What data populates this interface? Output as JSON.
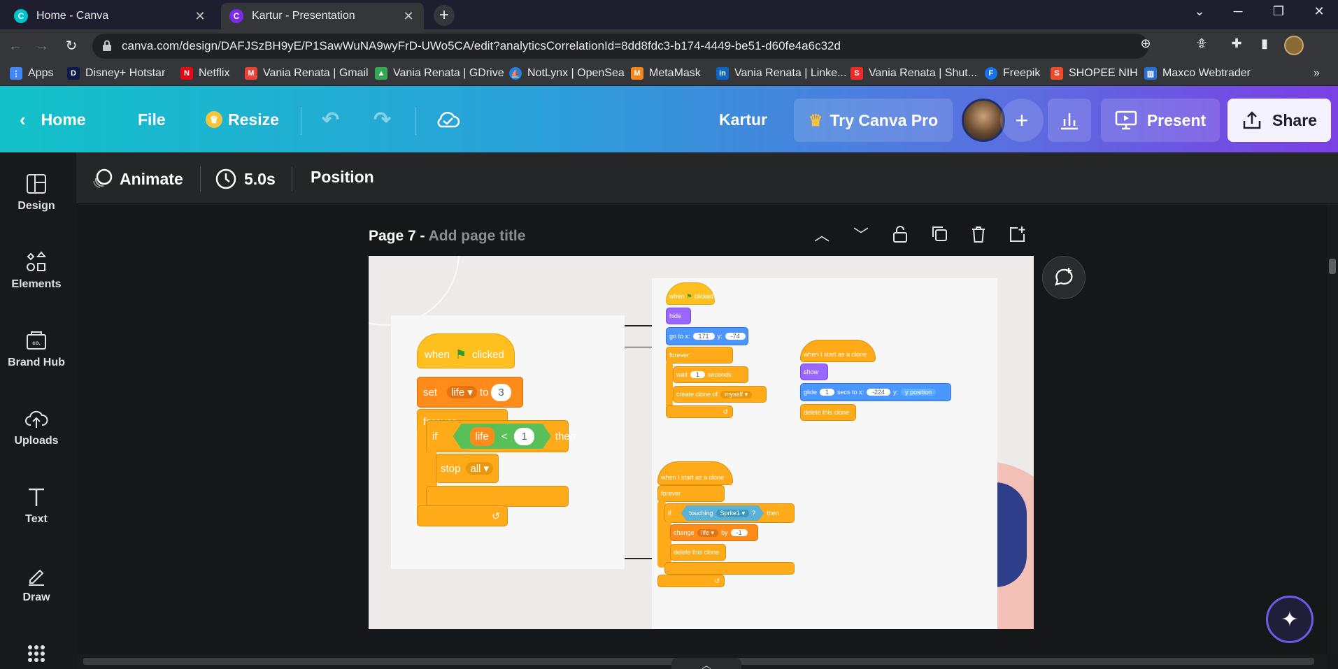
{
  "browser": {
    "tabs": [
      {
        "title": "Home - Canva",
        "active": false
      },
      {
        "title": "Kartur - Presentation",
        "active": true
      }
    ],
    "url": "canva.com/design/DAFJSzBH9yE/P1SawWuNA9wyFrD-UWo5CA/edit?analyticsCorrelationId=8dd8fdc3-b174-4449-be51-d60fe4a6c32d",
    "bookmarks": [
      {
        "label": "Apps",
        "icon": "apps-grid-icon",
        "color": "#4285f4"
      },
      {
        "label": "Disney+ Hotstar",
        "icon": "hotstar-icon",
        "color": "#0c1a4a"
      },
      {
        "label": "Netflix",
        "icon": "netflix-icon",
        "color": "#e50914"
      },
      {
        "label": "Vania Renata | Gmail",
        "icon": "gmail-icon",
        "color": "#ea4335"
      },
      {
        "label": "Vania Renata | GDrive",
        "icon": "gdrive-icon",
        "color": "#34a853"
      },
      {
        "label": "NotLynx | OpenSea",
        "icon": "opensea-icon",
        "color": "#2081e2"
      },
      {
        "label": "MetaMask",
        "icon": "metamask-icon",
        "color": "#f6851b"
      },
      {
        "label": "Vania Renata | Linke...",
        "icon": "linkedin-icon",
        "color": "#0a66c2"
      },
      {
        "label": "Vania Renata | Shut...",
        "icon": "shutterstock-icon",
        "color": "#ee2b24"
      },
      {
        "label": "Freepik",
        "icon": "freepik-icon",
        "color": "#1273eb"
      },
      {
        "label": "SHOPEE NIH",
        "icon": "shopee-icon",
        "color": "#ee4d2d"
      },
      {
        "label": "Maxco Webtrader",
        "icon": "maxco-icon",
        "color": "#2a6fd6"
      }
    ]
  },
  "canva": {
    "header": {
      "home": "Home",
      "file": "File",
      "resize": "Resize",
      "title": "Kartur",
      "try_pro": "Try Canva Pro",
      "present": "Present",
      "share": "Share"
    },
    "sidebar": [
      {
        "label": "Design",
        "icon": "design-layout-icon"
      },
      {
        "label": "Elements",
        "icon": "elements-shapes-icon"
      },
      {
        "label": "Brand Hub",
        "icon": "brand-hub-icon"
      },
      {
        "label": "Uploads",
        "icon": "upload-cloud-icon"
      },
      {
        "label": "Text",
        "icon": "text-t-icon"
      },
      {
        "label": "Draw",
        "icon": "draw-pen-icon"
      }
    ],
    "toolbar": {
      "animate": "Animate",
      "duration": "5.0s",
      "position": "Position"
    },
    "page": {
      "label": "Page 7 -",
      "title_placeholder": "Add page title"
    }
  },
  "slide": {
    "script1": {
      "hat": "when",
      "hat_end": "clicked",
      "set": "set",
      "set_var": "life",
      "set_to": "to",
      "set_val": "3",
      "forever": "forever",
      "if": "if",
      "cond_var": "life",
      "cond_op": "<",
      "cond_val": "1",
      "then": "then",
      "stop": "stop",
      "stop_opt": "all"
    },
    "script2": {
      "hat": "when",
      "hat_end": "clicked",
      "hide": "hide",
      "goto": "go to x:",
      "goto_x": "171",
      "goto_y_label": "y:",
      "goto_y": "-74",
      "forever": "forever",
      "wait": "wait",
      "wait_val": "1",
      "wait_unit": "seconds",
      "create_clone": "create clone of",
      "clone_target": "myself"
    },
    "script3": {
      "hat": "when I start as a clone",
      "show": "show",
      "glide": "glide",
      "glide_val": "1",
      "glide_mid": "secs to x:",
      "glide_x": "-224",
      "glide_y_label": "y:",
      "glide_y": "y position",
      "delete": "delete this clone"
    },
    "script4": {
      "hat": "when I start as a clone",
      "forever": "forever",
      "if": "if",
      "touching": "touching",
      "touch_target": "Sprite1",
      "q": "?",
      "then": "then",
      "change": "change",
      "change_var": "life",
      "by": "by",
      "by_val": "-1",
      "delete": "delete this clone"
    }
  }
}
